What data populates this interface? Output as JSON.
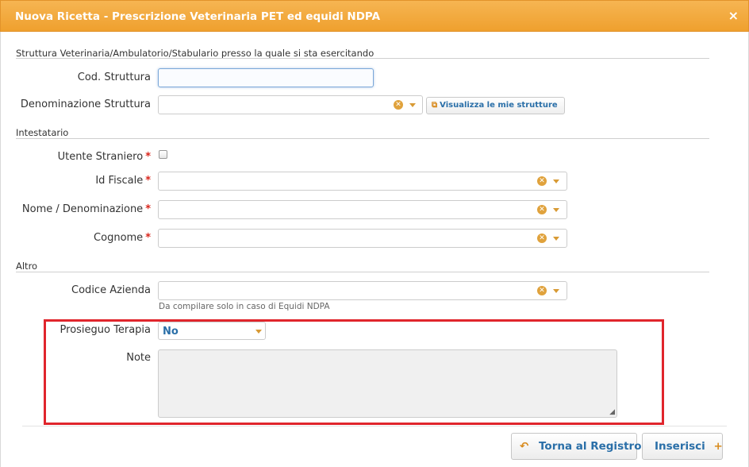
{
  "window": {
    "title": "Nuova Ricetta - Prescrizione Veterinaria PET ed equidi NDPA",
    "close_glyph": "×"
  },
  "section_struttura": {
    "title": "Struttura Veterinaria/Ambulatorio/Stabulario presso la quale si sta esercitando",
    "cod_label": "Cod. Struttura",
    "cod_value": "",
    "denominazione_label": "Denominazione Struttura",
    "denominazione_value": "",
    "visualizza_button": "Visualizza le mie strutture"
  },
  "section_intestatario": {
    "title": "Intestatario",
    "utente_label": "Utente Straniero",
    "utente_checked": false,
    "idfiscale_label": "Id Fiscale",
    "nome_label": "Nome / Denominazione",
    "cognome_label": "Cognome",
    "required_mark": "*"
  },
  "section_altro": {
    "title": "Altro",
    "codice_azienda_label": "Codice Azienda",
    "codice_azienda_hint": "Da compilare solo in caso di Equidi NDPA",
    "prosieguo_label": "Prosieguo Terapia",
    "prosieguo_value": "No",
    "note_label": "Note",
    "note_value": ""
  },
  "footer": {
    "torna_label": "Torna al Registro",
    "torna_icon": "↶",
    "inserisci_label": "Inserisci",
    "inserisci_icon": "+"
  },
  "colors": {
    "titlebar": "#efa02e",
    "accent_blue": "#2a6fa8",
    "required_red": "#d9261c",
    "highlight_red": "#e0252c"
  },
  "icons": {
    "clear": "clear-icon",
    "caret": "caret-down-icon",
    "external": "external-link-icon",
    "back": "undo-icon",
    "plus": "plus-icon",
    "close": "close-icon",
    "resize": "resize-grip-icon"
  }
}
